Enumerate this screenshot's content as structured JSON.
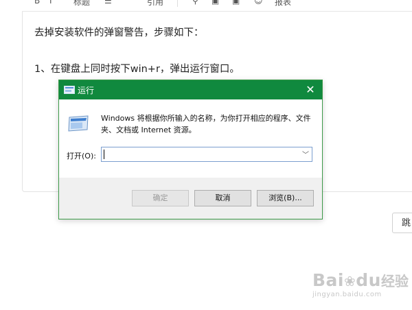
{
  "editor": {
    "toolbar": [
      "标题",
      "引用",
      "报表"
    ],
    "paragraph1": "去掉安装软件的弹窗警告，步骤如下：",
    "paragraph2": "1、在键盘上同时按下win+r，弹出运行窗口。"
  },
  "jump_button": "跳",
  "watermark": {
    "logo_text": "Bai",
    "logo_text2": "du",
    "cn": "经验",
    "url": "jingyan.baidu.com"
  },
  "dialog": {
    "title": "运行",
    "close_glyph": "✕",
    "description": "Windows 将根据你所输入的名称，为你打开相应的程序、文件夹、文档或 Internet 资源。",
    "open_label": "打开(O):",
    "open_value": "",
    "buttons": {
      "ok": "确定",
      "cancel": "取消",
      "browse": "浏览(B)..."
    }
  },
  "colors": {
    "titlebar": "#10893e",
    "border": "#3c9a48"
  }
}
